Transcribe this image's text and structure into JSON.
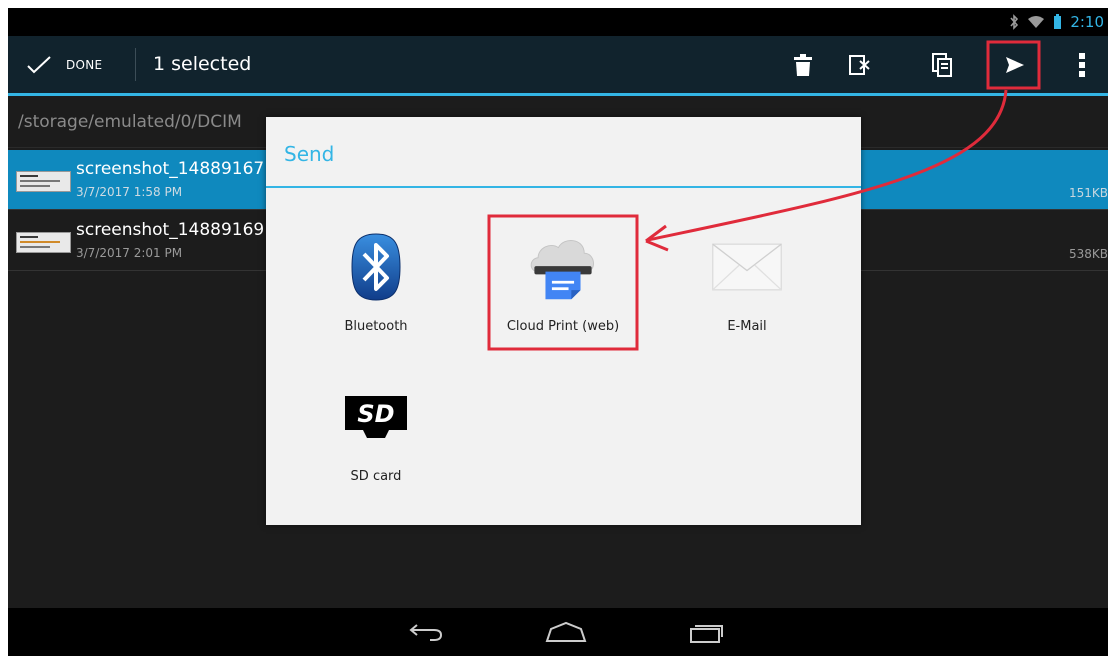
{
  "status_bar": {
    "time": "2:10",
    "icons": [
      "bluetooth-icon",
      "wifi-icon",
      "battery-icon"
    ]
  },
  "action_bar": {
    "done_label": "DONE",
    "selected_text": "1 selected",
    "actions": [
      "delete-icon",
      "cut-icon",
      "copy-icon",
      "send-icon",
      "overflow-menu-icon"
    ]
  },
  "path": "/storage/emulated/0/DCIM",
  "files": [
    {
      "name": "screenshot_14889167",
      "date": "3/7/2017 1:58 PM",
      "size": "151KB",
      "selected": true
    },
    {
      "name": "screenshot_14889169",
      "date": "3/7/2017 2:01 PM",
      "size": "538KB",
      "selected": false
    }
  ],
  "dialog": {
    "title": "Send",
    "apps": [
      {
        "label": "Bluetooth",
        "icon": "bluetooth-app-icon"
      },
      {
        "label": "Cloud Print (web)",
        "icon": "cloud-print-icon"
      },
      {
        "label": "E-Mail",
        "icon": "email-icon"
      },
      {
        "label": "SD card",
        "icon": "sd-card-icon"
      }
    ]
  },
  "nav": [
    "back-icon",
    "home-icon",
    "recent-apps-icon"
  ],
  "colors": {
    "accent": "#33b5e5",
    "selected_row": "#0f89be",
    "annotation": "#e02b3b"
  }
}
